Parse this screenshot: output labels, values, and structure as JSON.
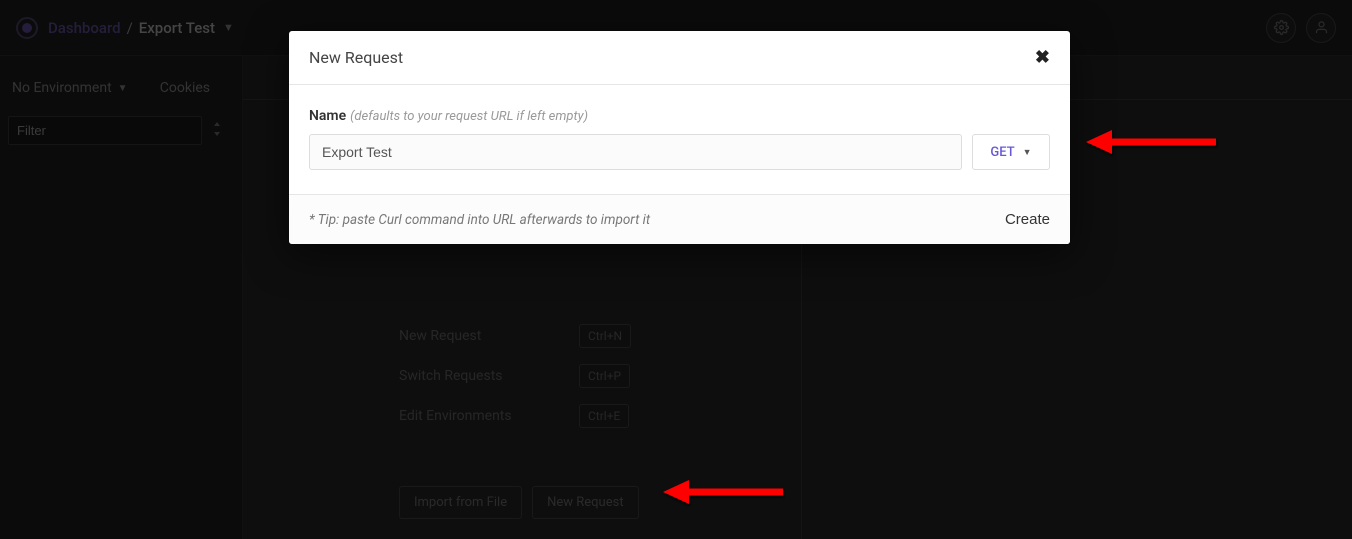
{
  "topbar": {
    "dashboard_label": "Dashboard",
    "separator": "/",
    "workspace_name": "Export Test"
  },
  "sidebar": {
    "environment_label": "No Environment",
    "cookies_label": "Cookies",
    "filter_placeholder": "Filter"
  },
  "hints": {
    "rows": [
      {
        "label": "New Request",
        "key": "Ctrl+N"
      },
      {
        "label": "Switch Requests",
        "key": "Ctrl+P"
      },
      {
        "label": "Edit Environments",
        "key": "Ctrl+E"
      }
    ],
    "import_btn": "Import from File",
    "new_request_btn": "New Request"
  },
  "modal": {
    "title": "New Request",
    "name_label": "Name",
    "name_hint": "(defaults to your request URL if left empty)",
    "name_value": "Export Test",
    "method": "GET",
    "tip": "* Tip: paste Curl command into URL afterwards to import it",
    "create_label": "Create"
  }
}
